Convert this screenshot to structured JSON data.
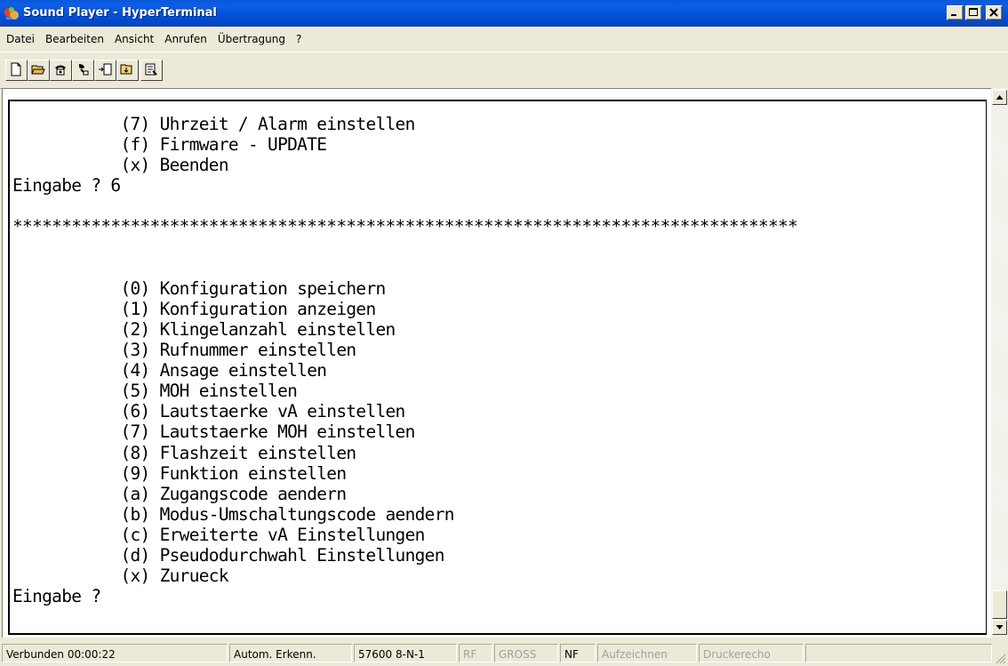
{
  "window": {
    "title": "Sound Player - HyperTerminal",
    "icon": "hyperterminal-icon"
  },
  "menu": [
    {
      "label": "Datei"
    },
    {
      "label": "Bearbeiten"
    },
    {
      "label": "Ansicht"
    },
    {
      "label": "Anrufen"
    },
    {
      "label": "Übertragung"
    },
    {
      "label": "?"
    }
  ],
  "toolbar": [
    {
      "icon": "new-icon"
    },
    {
      "icon": "open-icon"
    },
    {
      "icon": "call-icon"
    },
    {
      "icon": "disconnect-icon"
    },
    {
      "icon": "send-icon"
    },
    {
      "icon": "receive-icon"
    },
    {
      "icon": "properties-icon"
    }
  ],
  "terminal": {
    "lines": [
      "           (7) Uhrzeit / Alarm einstellen",
      "           (f) Firmware - UPDATE",
      "           (x) Beenden",
      "Eingabe ? 6",
      "",
      "********************************************************************************",
      "",
      "",
      "           (0) Konfiguration speichern",
      "           (1) Konfiguration anzeigen",
      "           (2) Klingelanzahl einstellen",
      "           (3) Rufnummer einstellen",
      "           (4) Ansage einstellen",
      "           (5) MOH einstellen",
      "           (6) Lautstaerke vA einstellen",
      "           (7) Lautstaerke MOH einstellen",
      "           (8) Flashzeit einstellen",
      "           (9) Funktion einstellen",
      "           (a) Zugangscode aendern",
      "           (b) Modus-Umschaltungscode aendern",
      "           (c) Erweiterte vA Einstellungen",
      "           (d) Pseudodurchwahl Einstellungen",
      "           (x) Zurueck",
      "Eingabe ?"
    ]
  },
  "status": {
    "connected": "Verbunden 00:00:22",
    "detect": "Autom. Erkenn.",
    "port": "57600 8-N-1",
    "rf": "RF",
    "gross": "GROSS",
    "nf": "NF",
    "record": "Aufzeichnen",
    "print": "Druckerecho"
  }
}
